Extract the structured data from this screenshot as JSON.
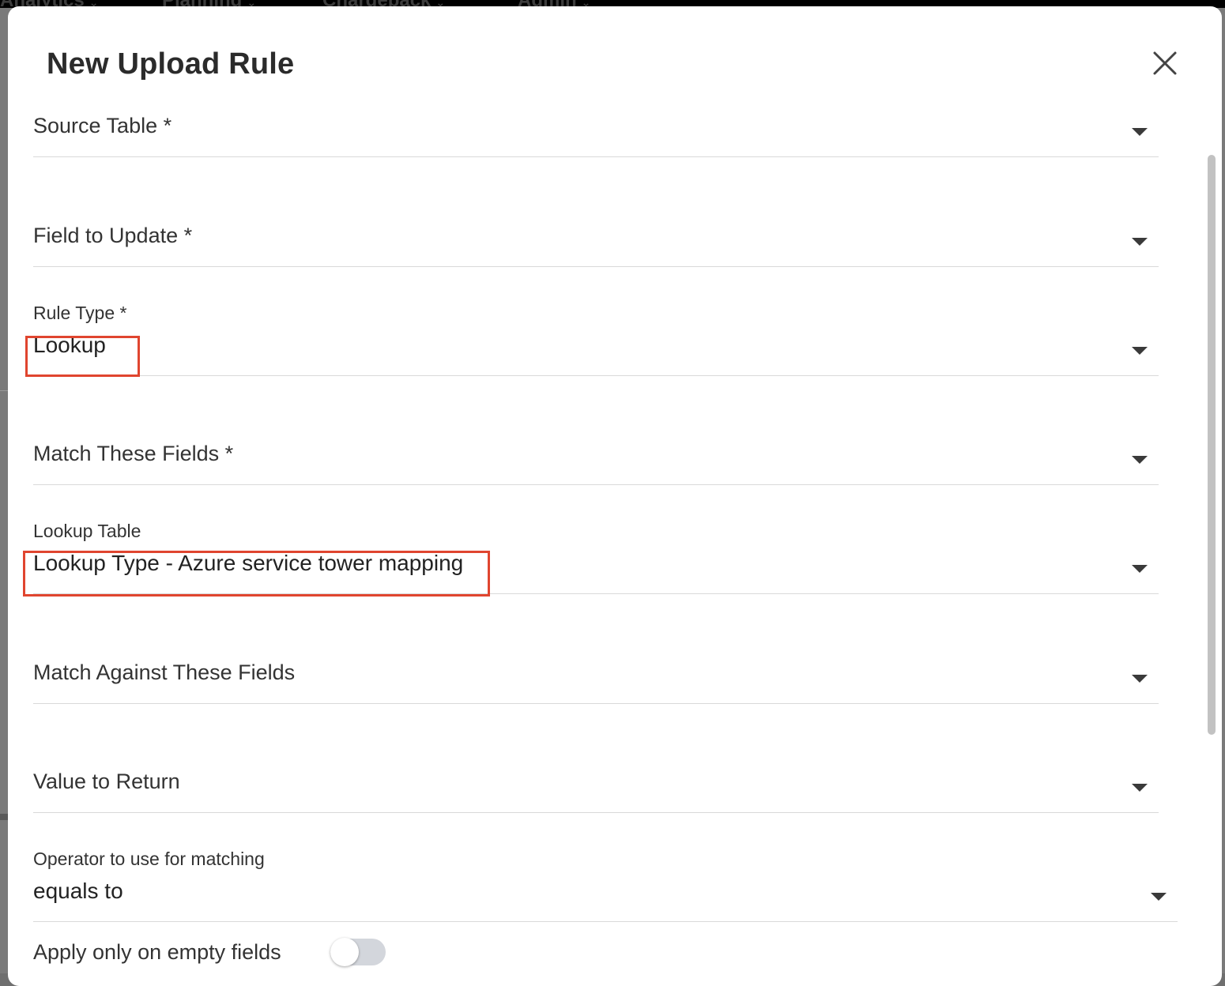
{
  "background": {
    "nav": [
      {
        "label": "Analytics"
      },
      {
        "label": "Planning"
      },
      {
        "label": "Chargeback"
      },
      {
        "label": "Admin"
      }
    ]
  },
  "modal": {
    "title": "New Upload Rule",
    "close_icon": "close-icon",
    "fields": {
      "source_table": {
        "label": "Source Table *",
        "value": ""
      },
      "field_to_update": {
        "label": "Field to Update *",
        "value": ""
      },
      "rule_type": {
        "label": "Rule Type *",
        "value": "Lookup"
      },
      "match_these_fields": {
        "label": "Match These Fields *",
        "value": ""
      },
      "lookup_table": {
        "label": "Lookup Table",
        "value": "Lookup Type - Azure service tower mapping"
      },
      "match_against_fields": {
        "label": "Match Against These Fields",
        "value": ""
      },
      "value_to_return": {
        "label": "Value to Return",
        "value": ""
      },
      "operator": {
        "label": "Operator to use for matching",
        "value": "equals to"
      }
    },
    "apply_only_empty": {
      "label": "Apply only on empty fields",
      "enabled": false
    }
  },
  "colors": {
    "highlight": "#e0452f",
    "underline": "#d9d9d9",
    "toggle_off": "#d3d6dc"
  }
}
